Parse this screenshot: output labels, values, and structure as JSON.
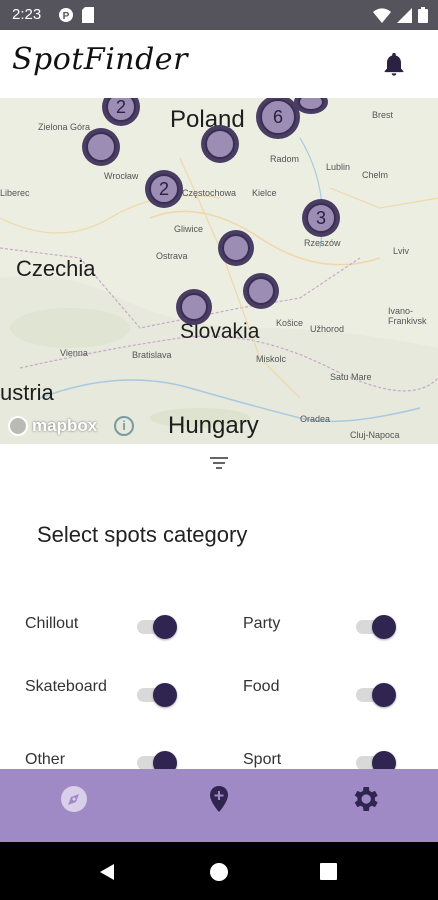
{
  "status_bar": {
    "time": "2:23"
  },
  "app_bar": {
    "title": "SpotFinder"
  },
  "map": {
    "labels": {
      "poland": "Poland",
      "czechia": "Czechia",
      "slovakia": "Slovakia",
      "hungary": "Hungary",
      "austria": "ustria"
    },
    "cities": [
      "Zielona Góra",
      "Wrocław",
      "Częstochowa",
      "Gliwice",
      "Ostrava",
      "Radom",
      "Lublin",
      "Kielce",
      "Rzeszów",
      "Lviv",
      "Chelm",
      "Brest",
      "Košice",
      "Užhorod",
      "Vienna",
      "Bratislava",
      "Miskolc",
      "Satu Mare",
      "Oradea",
      "Cluj-Napoca",
      "Ivano-Frankivsk",
      "Liberec"
    ],
    "clusters": [
      "2",
      "",
      "",
      "6",
      "",
      "2",
      "3",
      "",
      "",
      ""
    ],
    "attribution": "mapbox"
  },
  "sheet": {
    "title": "Select spots category",
    "categories": [
      {
        "label": "Chillout",
        "enabled": true
      },
      {
        "label": "Party",
        "enabled": true
      },
      {
        "label": "Skateboard",
        "enabled": true
      },
      {
        "label": "Food",
        "enabled": true
      },
      {
        "label": "Other",
        "enabled": true
      },
      {
        "label": "Sport",
        "enabled": true
      }
    ]
  },
  "bottom_nav": {
    "items": [
      "explore",
      "add-spot",
      "settings"
    ],
    "active": "explore"
  },
  "colors": {
    "accent": "#a08ac5",
    "primary_dark": "#2f2550",
    "status_bar": "#55535b"
  }
}
